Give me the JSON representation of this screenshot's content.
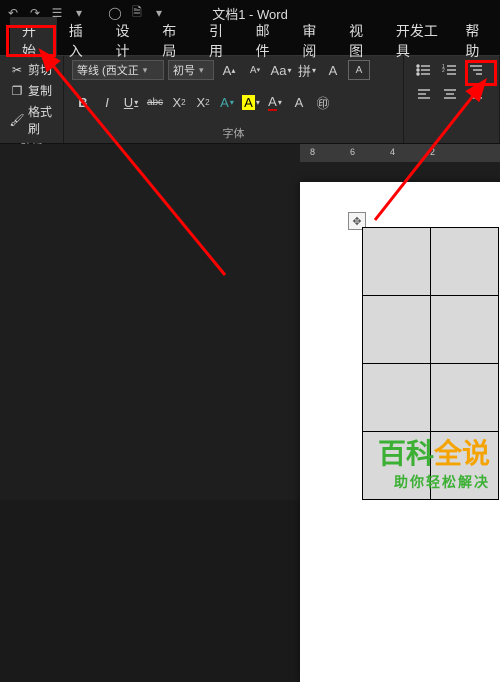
{
  "title": "文档1 - Word",
  "tabs": {
    "home": "开始",
    "insert": "插入",
    "design": "设计",
    "layout": "布局",
    "references": "引用",
    "mail": "邮件",
    "review": "审阅",
    "view": "视图",
    "developer": "开发工具",
    "help": "帮助"
  },
  "clipboard": {
    "cut": "剪切",
    "copy": "复制",
    "format_painter": "格式刷",
    "group_label": "贴板"
  },
  "font": {
    "family": "等线 (西文正",
    "size": "初号",
    "group_label": "字体",
    "bold": "B",
    "italic": "I",
    "underline": "U",
    "strike": "abc",
    "sub": "X",
    "sup": "X",
    "clear": "A",
    "case": "Aa",
    "highlight": "A",
    "color": "A",
    "grow": "A",
    "shrink": "A",
    "phonetic": "拼"
  },
  "ruler": {
    "n1": "8",
    "n2": "6",
    "n3": "4",
    "n4": "2"
  },
  "watermark": {
    "line1a": "百科",
    "line1b": "全说",
    "line2": "助你轻松解决"
  }
}
